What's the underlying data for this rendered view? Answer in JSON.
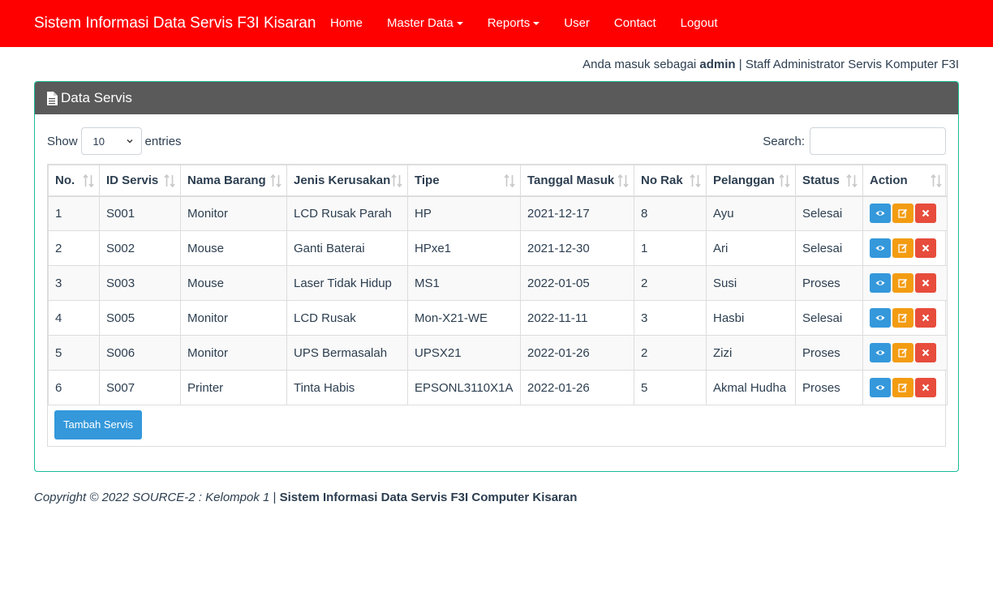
{
  "navbar": {
    "brand": "Sistem Informasi Data Servis F3I Kisaran",
    "items": [
      {
        "label": "Home",
        "dropdown": false
      },
      {
        "label": "Master Data",
        "dropdown": true
      },
      {
        "label": "Reports",
        "dropdown": true
      },
      {
        "label": "User",
        "dropdown": false
      },
      {
        "label": "Contact",
        "dropdown": false
      },
      {
        "label": "Logout",
        "dropdown": false
      }
    ]
  },
  "login": {
    "prefix": "Anda masuk sebagai ",
    "username": "admin",
    "suffix": " | Staff Administrator Servis Komputer F3I"
  },
  "panel": {
    "title": "Data Servis"
  },
  "table_controls": {
    "show_label": "Show",
    "entries_value": "10",
    "entries_label": "entries",
    "search_label": "Search:",
    "search_value": ""
  },
  "table": {
    "columns": [
      "No.",
      "ID Servis",
      "Nama Barang",
      "Jenis Kerusakan",
      "Tipe",
      "Tanggal Masuk",
      "No Rak",
      "Pelanggan",
      "Status",
      "Action"
    ],
    "rows": [
      [
        "1",
        "S001",
        "Monitor",
        "LCD Rusak Parah",
        "HP",
        "2021-12-17",
        "8",
        "Ayu",
        "Selesai"
      ],
      [
        "2",
        "S002",
        "Mouse",
        "Ganti Baterai",
        "HPxe1",
        "2021-12-30",
        "1",
        "Ari",
        "Selesai"
      ],
      [
        "3",
        "S003",
        "Mouse",
        "Laser Tidak Hidup",
        "MS1",
        "2022-01-05",
        "2",
        "Susi",
        "Proses"
      ],
      [
        "4",
        "S005",
        "Monitor",
        "LCD Rusak",
        "Mon-X21-WE",
        "2022-11-11",
        "3",
        "Hasbi",
        "Selesai"
      ],
      [
        "5",
        "S006",
        "Monitor",
        "UPS Bermasalah",
        "UPSX21",
        "2022-01-26",
        "2",
        "Zizi",
        "Proses"
      ],
      [
        "6",
        "S007",
        "Printer",
        "Tinta Habis",
        "EPSONL3110X1A",
        "2022-01-26",
        "5",
        "Akmal Hudha",
        "Proses"
      ]
    ],
    "action_icons": [
      "eye-icon",
      "edit-icon",
      "close-icon"
    ]
  },
  "add_button": {
    "label": "Tambah Servis"
  },
  "footer": {
    "copyright": "Copyright © 2022 SOURCE-2 : Kelompok 1",
    "separator": " | ",
    "app_name": "Sistem Informasi Data Servis F3I Computer Kisaran"
  },
  "colors": {
    "navbar_bg": "#ff0000",
    "panel_heading_bg": "#5a5a5a",
    "panel_border": "#18bc9c",
    "view_button": "#3498db",
    "edit_button": "#f39c12",
    "delete_button": "#e74c3c"
  }
}
